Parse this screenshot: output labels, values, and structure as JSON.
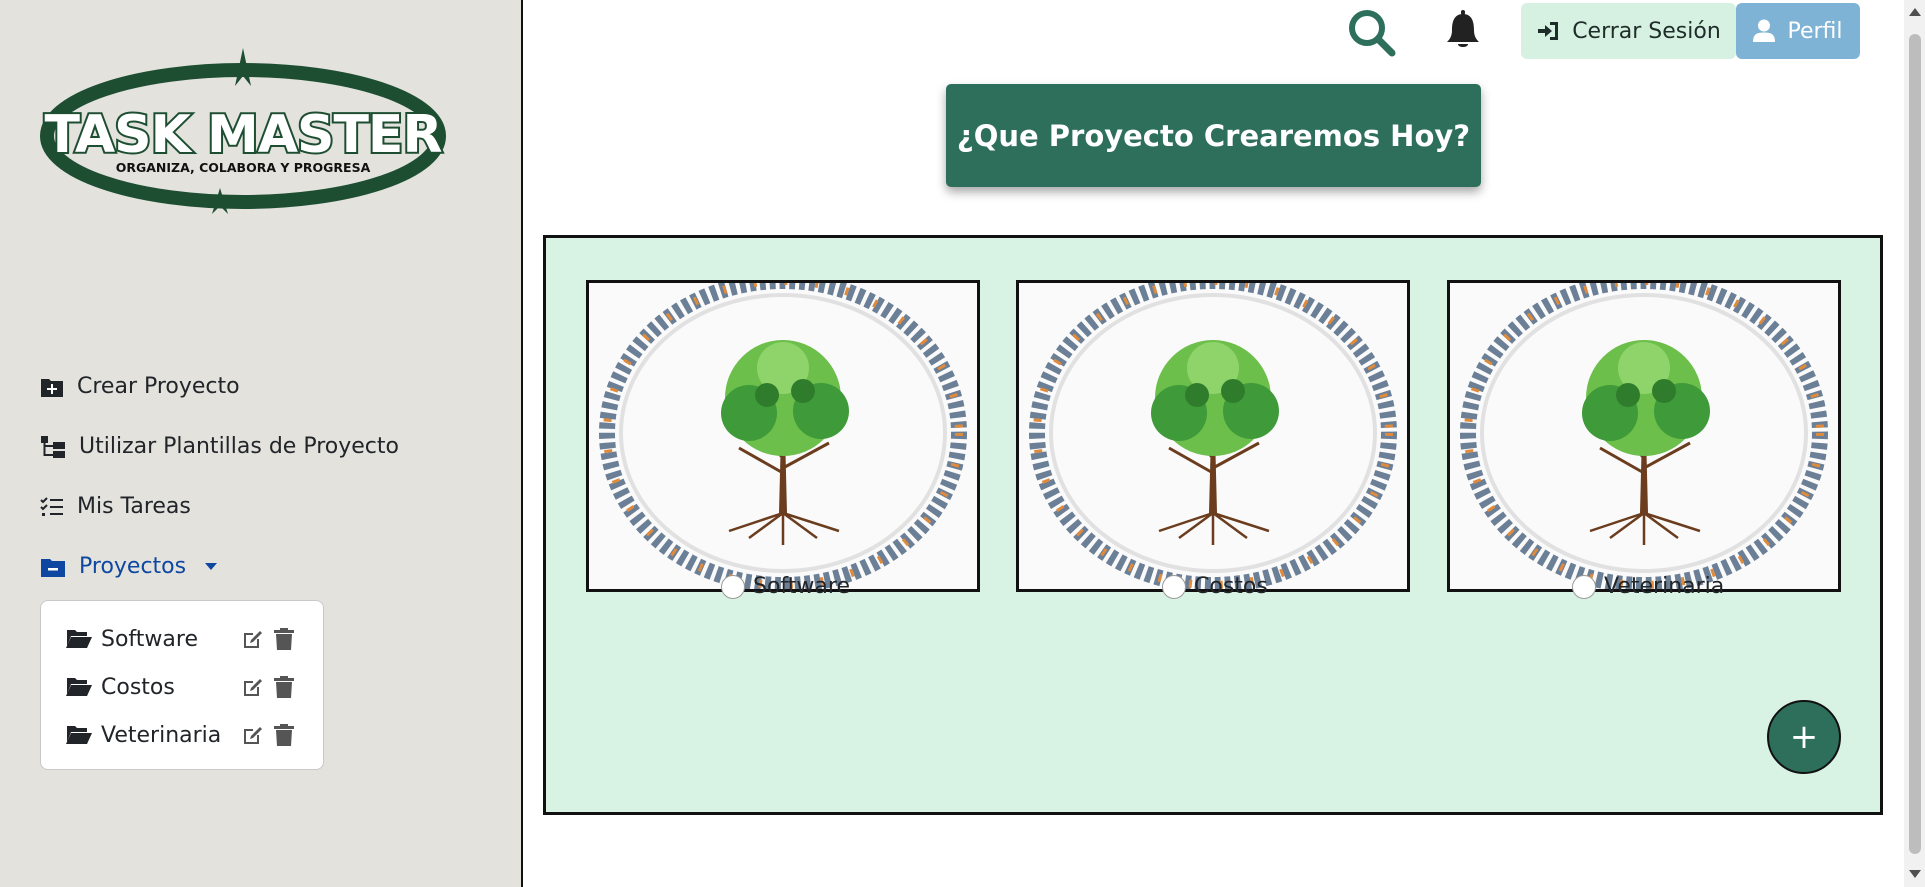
{
  "app": {
    "logo_title": "TASK MASTER",
    "logo_tagline": "ORGANIZA, COLABORA Y PROGRESA"
  },
  "sidebar": {
    "items": [
      {
        "label": "Crear Proyecto",
        "icon": "file-plus-icon"
      },
      {
        "label": "Utilizar Plantillas de Proyecto",
        "icon": "sitemap-icon"
      },
      {
        "label": "Mis Tareas",
        "icon": "list-check-icon"
      },
      {
        "label": "Proyectos",
        "icon": "folder-minus-icon",
        "active": true,
        "expanded": true
      }
    ],
    "projects": [
      {
        "name": "Software"
      },
      {
        "name": "Costos"
      },
      {
        "name": "Veterinaria"
      }
    ]
  },
  "topbar": {
    "search_icon": "search-icon",
    "notifications_icon": "bell-icon",
    "logout_label": "Cerrar Sesión",
    "profile_label": "Perfil"
  },
  "main": {
    "headline": "¿Que Proyecto Crearemos Hoy?",
    "cards": [
      {
        "label": "Software",
        "image": "tree-with-circle-of-people"
      },
      {
        "label": "Costos",
        "image": "tree-with-circle-of-people"
      },
      {
        "label": "Veterinaria",
        "image": "tree-with-circle-of-people"
      }
    ],
    "add_button_label": "+"
  },
  "colors": {
    "sidebar_bg": "#e3e2dd",
    "primary_green": "#2d6f5b",
    "panel_bg": "#d8f3e3",
    "logout_bg": "#d6f1e1",
    "profile_bg": "#7fb3d5",
    "active_link": "#0d47a1"
  }
}
